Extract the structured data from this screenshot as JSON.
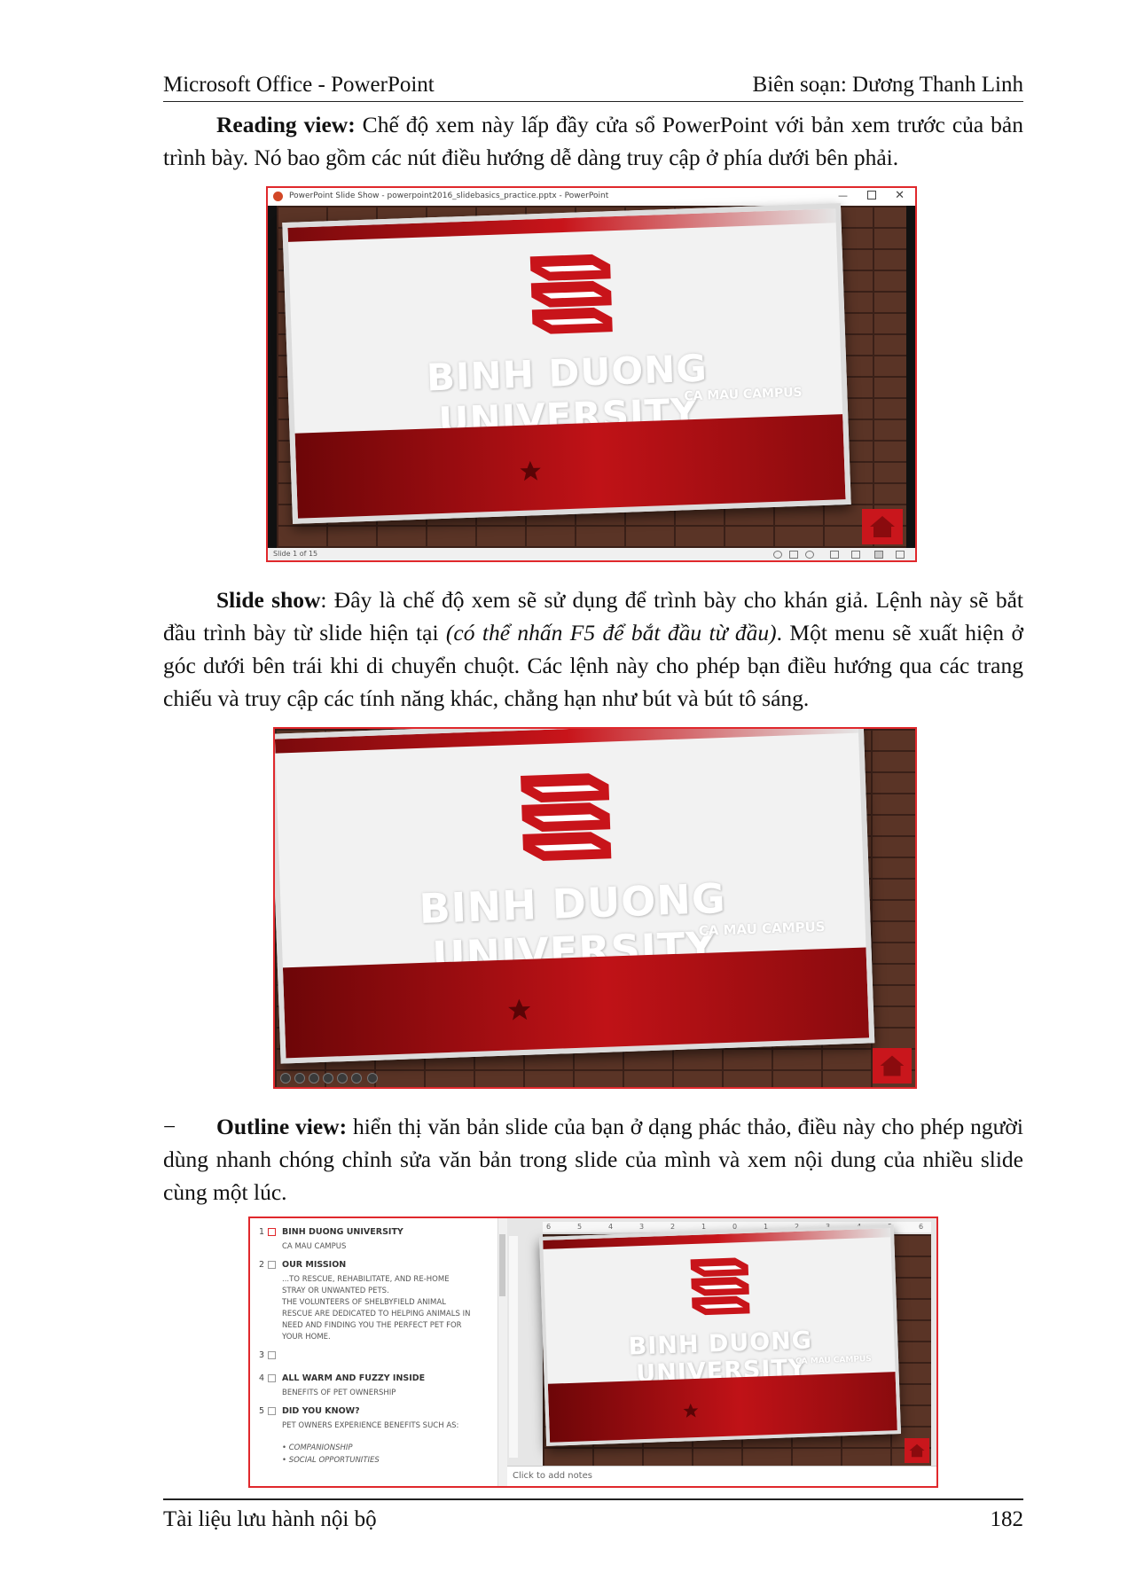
{
  "header": {
    "left": "Microsoft Office - PowerPoint",
    "right": "Biên soạn: Dương Thanh Linh"
  },
  "reading_view": {
    "term": "Reading view:",
    "text": " Chế độ xem này lấp đầy cửa sổ PowerPoint với bản xem trước của bản trình bày. Nó bao gồm các nút điều hướng dễ dàng truy cập ở phía dưới bên phải."
  },
  "figure1": {
    "window_title": "PowerPoint Slide Show - powerpoint2016_slidebasics_practice.pptx - PowerPoint",
    "status_text": "Slide 1 of 15",
    "slide_title": "BINH DUONG UNIVERSITY",
    "slide_subtitle": "CA MAU CAMPUS",
    "icons": [
      "powerpoint-icon",
      "minimize-icon",
      "maximize-icon",
      "close-icon",
      "book-stack-icon",
      "star-icon",
      "home-icon"
    ]
  },
  "slide_show": {
    "term": "Slide show",
    "text_a": ":  Đây là chế độ xem sẽ sử dụng để trình bày cho khán giả. Lệnh này sẽ bắt đầu trình bày từ slide hiện tại ",
    "text_italic": "(có thể nhấn F5 để bắt đầu từ đầu)",
    "text_b": ". Một menu sẽ xuất hiện ở góc dưới bên trái khi di chuyển chuột. Các lệnh này cho phép bạn điều hướng qua các trang chiếu và truy cập các tính năng khác, chẳng hạn như bút và bút tô sáng."
  },
  "figure2": {
    "slide_title": "BINH DUONG UNIVERSITY",
    "slide_subtitle": "CA MAU CAMPUS"
  },
  "outline_view": {
    "dash": "−",
    "term": "Outline view:",
    "text": " hiển thị văn bản slide của bạn ở dạng phác thảo, điều này cho phép người dùng nhanh chóng chỉnh sửa văn bản trong slide của mình và xem nội dung của nhiều slide cùng một lúc."
  },
  "figure3": {
    "outline": [
      {
        "num": "1",
        "title": "BINH DUONG UNIVERSITY",
        "lines": [
          "CA MAU CAMPUS"
        ]
      },
      {
        "num": "2",
        "title": "OUR MISSION",
        "lines": [
          "...TO RESCUE, REHABILITATE, AND RE-HOME",
          "STRAY OR UNWANTED PETS.",
          "THE VOLUNTEERS OF SHELBYFIELD ANIMAL",
          "RESCUE ARE DEDICATED TO HELPING ANIMALS IN",
          "NEED AND FINDING YOU THE PERFECT PET FOR",
          "YOUR HOME."
        ]
      },
      {
        "num": "3",
        "title": "",
        "lines": []
      },
      {
        "num": "4",
        "title": "ALL WARM AND FUZZY INSIDE",
        "lines": [
          "BENEFITS OF PET OWNERSHIP"
        ]
      },
      {
        "num": "5",
        "title": "DID YOU KNOW?",
        "lines": [
          "PET OWNERS EXPERIENCE BENEFITS SUCH AS:"
        ]
      }
    ],
    "bullets": [
      "• COMPANIONSHIP",
      "• SOCIAL OPPORTUNITIES"
    ],
    "ruler_labels": [
      "6",
      "5",
      "4",
      "3",
      "2",
      "1",
      "0",
      "1",
      "2",
      "3",
      "4",
      "5",
      "6"
    ],
    "notes_placeholder": "Click to add notes",
    "slide_title": "BINH DUONG UNIVERSITY",
    "slide_subtitle": "CA MAU CAMPUS"
  },
  "footer": {
    "left": "Tài liệu lưu hành nội bộ",
    "page": "182"
  }
}
